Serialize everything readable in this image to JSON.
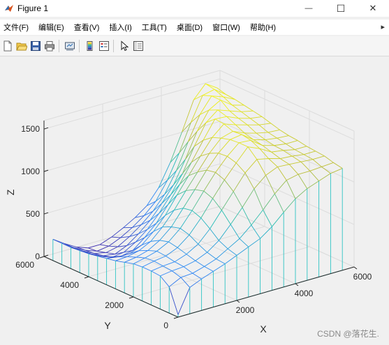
{
  "window": {
    "title": "Figure 1"
  },
  "menu": {
    "items": [
      "文件(F)",
      "编辑(E)",
      "查看(V)",
      "插入(I)",
      "工具(T)",
      "桌面(D)",
      "窗口(W)",
      "帮助(H)"
    ],
    "expand_arrow": "▸"
  },
  "controls": {
    "minimize": "—",
    "maximize": "☐",
    "close": "✕"
  },
  "toolbar": {
    "icons": [
      "new-figure-icon",
      "open-file-icon",
      "save-icon",
      "print-icon",
      "link-plot-icon",
      "colorbar-icon",
      "legend-icon",
      "edit-plot-icon",
      "property-inspector-icon"
    ]
  },
  "colors": {
    "axis": "#262626",
    "grid": "#dcdcdc",
    "background": "#f0f0f0"
  },
  "watermark": "CSDN @落花生.",
  "chart_data": {
    "type": "mesh",
    "xlabel": "X",
    "ylabel": "Y",
    "zlabel": "Z",
    "xlim": [
      0,
      6000
    ],
    "ylim": [
      0,
      6000
    ],
    "zlim": [
      0,
      1600
    ],
    "x_ticks": [
      2000,
      4000,
      6000
    ],
    "x_ticklabels": [
      "2000",
      "4000",
      "6000"
    ],
    "y_ticks": [
      0,
      2000,
      4000,
      6000
    ],
    "y_ticklabels": [
      "0",
      "2000",
      "4000",
      "6000"
    ],
    "z_ticks": [
      0,
      500,
      1000,
      1500
    ],
    "z_ticklabels": [
      "0",
      "500",
      "1000",
      "1500"
    ],
    "grid": true,
    "colormap": "parula",
    "x": [
      0,
      400,
      800,
      1200,
      1600,
      2000,
      2400,
      2800,
      3200,
      3600,
      4000,
      4400,
      4800,
      5200,
      5600
    ],
    "y": [
      0,
      400,
      800,
      1200,
      1600,
      2000,
      2400,
      2800,
      3200,
      3600,
      4000,
      4400,
      4800,
      5200,
      5600
    ],
    "z": [
      [
        30,
        310,
        370,
        420,
        470,
        530,
        590,
        650,
        750,
        880,
        1000,
        1080,
        1130,
        1180,
        1200
      ],
      [
        310,
        380,
        390,
        430,
        480,
        560,
        640,
        760,
        900,
        1050,
        1170,
        1200,
        1200,
        1210,
        1220
      ],
      [
        390,
        410,
        420,
        450,
        510,
        610,
        760,
        920,
        1100,
        1220,
        1280,
        1270,
        1260,
        1250,
        1250
      ],
      [
        400,
        420,
        430,
        480,
        560,
        700,
        880,
        1060,
        1240,
        1360,
        1330,
        1290,
        1280,
        1260,
        1260
      ],
      [
        400,
        430,
        450,
        510,
        620,
        780,
        970,
        1150,
        1310,
        1460,
        1400,
        1320,
        1300,
        1270,
        1270
      ],
      [
        390,
        420,
        460,
        530,
        650,
        820,
        1010,
        1190,
        1340,
        1460,
        1450,
        1350,
        1310,
        1290,
        1290
      ],
      [
        360,
        380,
        420,
        500,
        620,
        800,
        980,
        1170,
        1330,
        1450,
        1470,
        1370,
        1330,
        1310,
        1300
      ],
      [
        330,
        340,
        370,
        440,
        570,
        730,
        920,
        1100,
        1280,
        1420,
        1460,
        1400,
        1360,
        1330,
        1320
      ],
      [
        310,
        290,
        290,
        350,
        470,
        620,
        820,
        1010,
        1200,
        1380,
        1500,
        1450,
        1410,
        1370,
        1350
      ],
      [
        290,
        240,
        210,
        240,
        350,
        480,
        660,
        860,
        1080,
        1300,
        1510,
        1500,
        1440,
        1400,
        1380
      ],
      [
        270,
        200,
        150,
        170,
        250,
        360,
        510,
        690,
        900,
        1180,
        1420,
        1530,
        1480,
        1430,
        1400
      ],
      [
        260,
        180,
        120,
        100,
        160,
        260,
        380,
        540,
        720,
        980,
        1270,
        1480,
        1560,
        1460,
        1420
      ],
      [
        250,
        170,
        100,
        70,
        100,
        180,
        280,
        400,
        560,
        800,
        1100,
        1380,
        1560,
        1510,
        1440
      ],
      [
        250,
        160,
        90,
        40,
        60,
        120,
        200,
        300,
        430,
        640,
        920,
        1240,
        1520,
        1550,
        1450
      ],
      [
        250,
        160,
        80,
        30,
        30,
        80,
        150,
        230,
        330,
        500,
        760,
        1080,
        1420,
        1570,
        1480
      ]
    ]
  }
}
